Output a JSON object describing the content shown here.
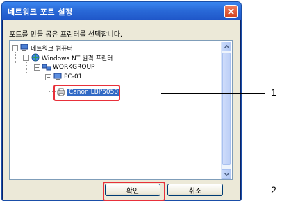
{
  "dialog": {
    "title": "네트워크 포트 설정",
    "instruction": "포트를 만들 공유 프린터를 선택합니다.",
    "tree": [
      {
        "label": "네트워크 컴퓨터",
        "icon": "network-computer-icon",
        "level": 0,
        "expanded": true
      },
      {
        "label": "Windows NT 원격 프린터",
        "icon": "globe-icon",
        "level": 1,
        "expanded": true
      },
      {
        "label": "WORKGROUP",
        "icon": "workgroup-icon",
        "level": 2,
        "expanded": true
      },
      {
        "label": "PC-01",
        "icon": "computer-icon",
        "level": 3,
        "expanded": true
      },
      {
        "label": "Canon LBP5050",
        "icon": "printer-icon",
        "level": 4,
        "selected": true
      }
    ],
    "buttons": {
      "ok": "확인",
      "cancel": "취소"
    }
  },
  "callouts": [
    "1",
    "2"
  ],
  "colors": {
    "title_bar": "#2a6ad8",
    "highlight": "#e8303a",
    "selection": "#316ac5"
  }
}
